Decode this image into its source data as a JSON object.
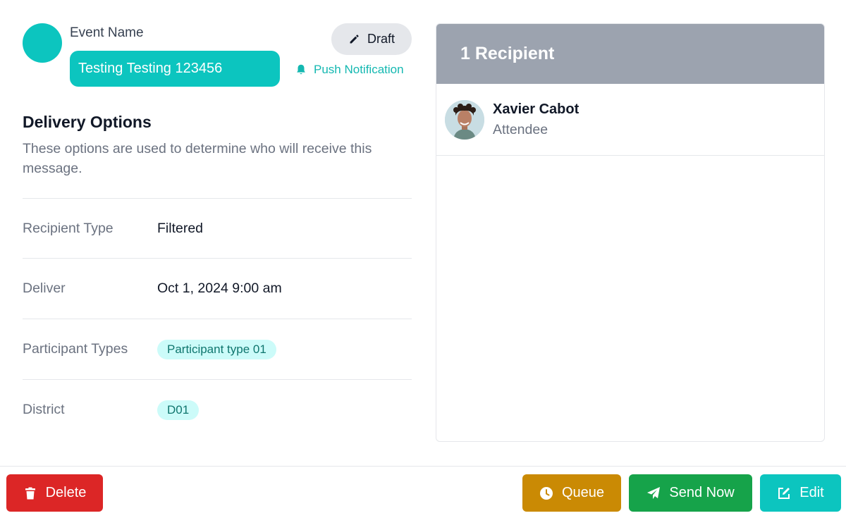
{
  "event": {
    "label": "Event Name",
    "name": "Testing Testing 123456",
    "status": "Draft",
    "channel": "Push Notification"
  },
  "delivery": {
    "title": "Delivery Options",
    "description": "These options are used to determine who will receive this message.",
    "rows": [
      {
        "label": "Recipient Type",
        "value": "Filtered"
      },
      {
        "label": "Deliver",
        "value": "Oct 1, 2024 9:00 am"
      },
      {
        "label": "Participant Types",
        "value": "Participant type 01"
      },
      {
        "label": "District",
        "value": "D01"
      }
    ]
  },
  "recipients": {
    "header": "1 Recipient",
    "items": [
      {
        "name": "Xavier Cabot",
        "role": "Attendee"
      }
    ]
  },
  "footer": {
    "delete": "Delete",
    "queue": "Queue",
    "send_now": "Send Now",
    "edit": "Edit"
  },
  "colors": {
    "accent": "#0cc5bf",
    "danger": "#dc2626",
    "warning": "#ca8a04",
    "success": "#16a34a",
    "header_gray": "#9ca3af"
  },
  "icons": {
    "draft": "pencil-icon",
    "channel": "bell-icon",
    "delete": "trash-icon",
    "queue": "clock-icon",
    "send_now": "paper-plane-icon",
    "edit": "edit-icon"
  }
}
